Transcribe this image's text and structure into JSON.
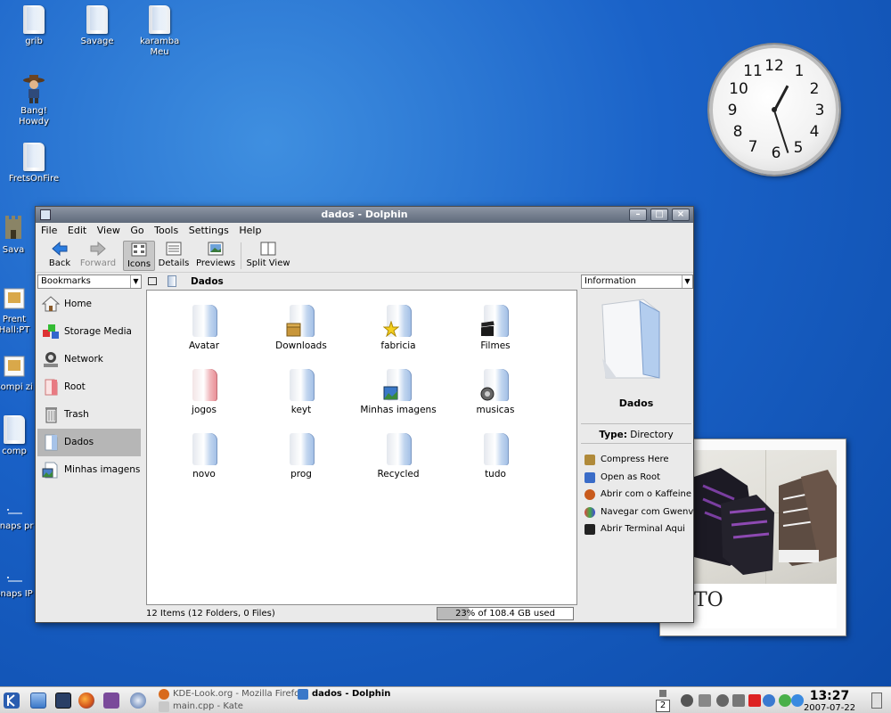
{
  "desktop": {
    "icons": [
      {
        "label": "grib"
      },
      {
        "label": "Savage"
      },
      {
        "label": "karamba Meu"
      },
      {
        "label": "Bang! Howdy"
      },
      {
        "label": "FretsOnFire"
      },
      {
        "label": "Sava"
      },
      {
        "label": "Prent Hall:PT"
      },
      {
        "label": "compi zi"
      },
      {
        "label": "comp"
      },
      {
        "label": "snaps pr"
      },
      {
        "label": "snaps IP"
      }
    ]
  },
  "clock_widget": {
    "numbers": [
      "12",
      "1",
      "2",
      "3",
      "4",
      "5",
      "6",
      "7",
      "8",
      "9",
      "10",
      "11"
    ]
  },
  "photo_widget": {
    "caption_fragment": "TO"
  },
  "window": {
    "title": "dados - Dolphin",
    "controls": {
      "minimize": "–",
      "maximize": "□",
      "close": "×"
    },
    "menu": [
      "File",
      "Edit",
      "View",
      "Go",
      "Tools",
      "Settings",
      "Help"
    ],
    "toolbar": {
      "back": "Back",
      "forward": "Forward",
      "icons": "Icons",
      "details": "Details",
      "previews": "Previews",
      "split_view": "Split View"
    },
    "bookmarks": {
      "combo": "Bookmarks",
      "items": [
        "Home",
        "Storage Media",
        "Network",
        "Root",
        "Trash",
        "Dados",
        "Minhas imagens"
      ],
      "selected": "Dados"
    },
    "location": "Dados",
    "files": [
      {
        "name": "Avatar",
        "emblem": "none",
        "color": "blue"
      },
      {
        "name": "Downloads",
        "emblem": "box",
        "color": "blue"
      },
      {
        "name": "fabricia",
        "emblem": "star",
        "color": "blue"
      },
      {
        "name": "Filmes",
        "emblem": "clapper",
        "color": "blue"
      },
      {
        "name": "jogos",
        "emblem": "none",
        "color": "red"
      },
      {
        "name": "keyt",
        "emblem": "none",
        "color": "blue"
      },
      {
        "name": "Minhas imagens",
        "emblem": "picture",
        "color": "blue"
      },
      {
        "name": "musicas",
        "emblem": "speaker",
        "color": "blue"
      },
      {
        "name": "novo",
        "emblem": "none",
        "color": "blue"
      },
      {
        "name": "prog",
        "emblem": "none",
        "color": "blue"
      },
      {
        "name": "Recycled",
        "emblem": "none",
        "color": "blue"
      },
      {
        "name": "tudo",
        "emblem": "none",
        "color": "blue"
      }
    ],
    "status": "12 Items (12 Folders, 0 Files)",
    "disk_usage": {
      "label": "23% of 108.4 GB used",
      "percent": 23
    },
    "info_panel": {
      "combo": "Information",
      "name": "Dados",
      "type_label": "Type:",
      "type_value": "Directory",
      "actions": [
        "Compress Here",
        "Open as Root",
        "Abrir com o Kaffeine",
        "Navegar com Gwenview",
        "Abrir Terminal Aqui"
      ]
    }
  },
  "taskbar": {
    "tasks": [
      "KDE-Look.org - Mozilla Firefox",
      "main.cpp - Kate",
      "dados - Dolphin"
    ],
    "active_task": "dados - Dolphin",
    "pager": "2",
    "time": "13:27",
    "date": "2007-07-22"
  },
  "colors": {
    "desktop": "#1a62c8",
    "titlebar": "#6b7586",
    "selection": "#b6b6b6"
  }
}
